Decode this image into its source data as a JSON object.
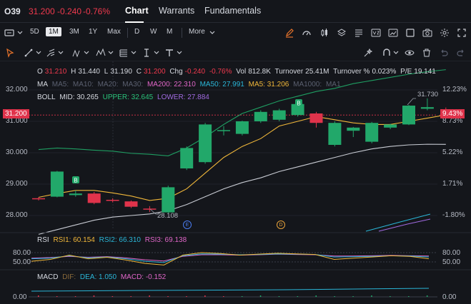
{
  "header": {
    "ticker": "O39",
    "price": "31.200",
    "change": "-0.240",
    "change_pct": "-0.76%",
    "tabs": [
      {
        "label": "Chart",
        "active": true
      },
      {
        "label": "Warrants",
        "active": false
      },
      {
        "label": "Fundamentals",
        "active": false
      }
    ]
  },
  "toolbar": {
    "periods": [
      "5D",
      "1M",
      "3M",
      "1Y",
      "Max"
    ],
    "selected_period": "1M",
    "intervals": [
      "D",
      "W",
      "M"
    ],
    "more_label": "More",
    "accent": "#e8732a"
  },
  "stats": {
    "o_label": "O",
    "o": "31.210",
    "h_label": "H",
    "h": "31.440",
    "l_label": "L",
    "l": "31.190",
    "c_label": "C",
    "c": "31.200",
    "chg_label": "Chg",
    "chg": "-0.240",
    "chg_pct": "-0.76%",
    "vol_label": "Vol",
    "vol": "812.8K",
    "turnover_label": "Turnover",
    "turnover": "25.41M",
    "turnover_pct_label": "Turnover %",
    "turnover_pct": "0.023%",
    "pe_label": "P/E",
    "pe": "19.141"
  },
  "ma_legend": {
    "label": "MA",
    "items": [
      {
        "text": "MA5:",
        "color": "#5b6070"
      },
      {
        "text": "MA10:",
        "color": "#5b6070"
      },
      {
        "text": "MA20:",
        "color": "#5b6070"
      },
      {
        "text": "MA30:",
        "color": "#5b6070"
      },
      {
        "text": "MA200: 22.310",
        "color": "#e066c8"
      },
      {
        "text": "MA50: 27.991",
        "color": "#2ab6d8"
      },
      {
        "text": "MA5: 31.206",
        "color": "#f0b73a"
      },
      {
        "text": "MA1000:",
        "color": "#5b6070"
      },
      {
        "text": "MA1",
        "color": "#5b6070"
      }
    ]
  },
  "boll_legend": {
    "label": "BOLL",
    "mid": "MID: 30.265",
    "upper": "UPPER: 32.645",
    "lower": "LOWER: 27.884"
  },
  "price_axis": [
    "32.000",
    "31.000",
    "30.000",
    "29.000",
    "28.000"
  ],
  "pct_axis": [
    "12.23%",
    "8.73%",
    "5.22%",
    "1.71%",
    "-1.80%"
  ],
  "current_price_tag": "31.200",
  "current_pct_tag": "9.43%",
  "annotations": {
    "high": "31.730",
    "low": "28.108"
  },
  "rsi": {
    "label": "RSI",
    "rsi1": "RSI1: 60.154",
    "rsi2": "RSI2: 66.310",
    "rsi3": "RSI3: 69.138",
    "levels_left": [
      "80.00",
      "50.00"
    ],
    "levels_right": [
      "80.00",
      "50.00"
    ],
    "rsi1_values": [
      52,
      58,
      72,
      60,
      65,
      56,
      45,
      40,
      72,
      80,
      77,
      72,
      75,
      78,
      76,
      74,
      58,
      62,
      66,
      70,
      68,
      60
    ],
    "rsi2_values": [
      60,
      62,
      70,
      63,
      66,
      60,
      52,
      48,
      70,
      76,
      75,
      73,
      74,
      76,
      75,
      74,
      66,
      67,
      68,
      70,
      69,
      66
    ],
    "rsi3_values": [
      62,
      64,
      68,
      65,
      67,
      63,
      57,
      53,
      68,
      73,
      73,
      72,
      73,
      75,
      74,
      73,
      69,
      69,
      70,
      71,
      70,
      69
    ]
  },
  "macd": {
    "label": "MACD",
    "dif": "DIF:",
    "dea": "DEA: 1.050",
    "macd": "MACD: -0.152",
    "level": "0.00"
  },
  "chart_data": {
    "type": "candlestick",
    "candles": [
      {
        "o": 28.55,
        "c": 28.52,
        "h": 28.58,
        "l": 28.48
      },
      {
        "o": 28.6,
        "c": 29.4,
        "h": 29.42,
        "l": 28.58
      },
      {
        "o": 28.65,
        "c": 28.7,
        "h": 28.8,
        "l": 28.6
      },
      {
        "o": 28.7,
        "c": 28.4,
        "h": 28.75,
        "l": 28.36
      },
      {
        "o": 28.5,
        "c": 28.47,
        "h": 28.55,
        "l": 28.42
      },
      {
        "o": 28.45,
        "c": 28.28,
        "h": 28.48,
        "l": 28.24
      },
      {
        "o": 28.22,
        "c": 28.2,
        "h": 28.3,
        "l": 28.108
      },
      {
        "o": 28.1,
        "c": 28.9,
        "h": 28.95,
        "l": 28.08
      },
      {
        "o": 29.5,
        "c": 30.15,
        "h": 30.2,
        "l": 29.45
      },
      {
        "o": 29.7,
        "c": 30.9,
        "h": 30.95,
        "l": 29.65
      },
      {
        "o": 30.7,
        "c": 30.72,
        "h": 30.85,
        "l": 30.55
      },
      {
        "o": 30.6,
        "c": 31.0,
        "h": 31.02,
        "l": 30.55
      },
      {
        "o": 31.0,
        "c": 31.3,
        "h": 31.35,
        "l": 30.95
      },
      {
        "o": 31.05,
        "c": 31.35,
        "h": 31.4,
        "l": 31.0
      },
      {
        "o": 31.2,
        "c": 31.55,
        "h": 31.6,
        "l": 31.15
      },
      {
        "o": 31.25,
        "c": 30.95,
        "h": 31.3,
        "l": 30.8
      },
      {
        "o": 30.25,
        "c": 30.95,
        "h": 31.0,
        "l": 30.2
      },
      {
        "o": 30.7,
        "c": 30.8,
        "h": 30.82,
        "l": 30.5
      },
      {
        "o": 30.35,
        "c": 30.95,
        "h": 30.98,
        "l": 30.3
      },
      {
        "o": 30.8,
        "c": 30.9,
        "h": 30.92,
        "l": 30.75
      },
      {
        "o": 30.9,
        "c": 31.5,
        "h": 31.52,
        "l": 30.88
      },
      {
        "o": 31.4,
        "c": 31.45,
        "h": 31.73,
        "l": 31.35
      },
      {
        "o": 31.21,
        "c": 31.2,
        "h": 31.44,
        "l": 31.19
      }
    ],
    "ma5": [
      28.58,
      28.7,
      28.8,
      28.8,
      28.72,
      28.62,
      28.48,
      28.55,
      28.85,
      29.35,
      29.85,
      30.2,
      30.45,
      30.85,
      31.0,
      31.15,
      31.05,
      30.95,
      30.9,
      30.9,
      31.0,
      31.1,
      31.206
    ],
    "boll_mid": [
      27.4,
      27.55,
      27.7,
      27.85,
      27.95,
      28.0,
      28.05,
      28.15,
      28.35,
      28.6,
      28.85,
      29.05,
      29.2,
      29.4,
      29.55,
      29.7,
      29.85,
      30.0,
      30.12,
      30.2,
      30.25,
      30.27,
      30.265
    ],
    "boll_upper": [
      30.1,
      30.15,
      30.12,
      30.08,
      30.05,
      29.98,
      29.95,
      29.9,
      30.15,
      30.5,
      30.9,
      31.25,
      31.45,
      31.65,
      31.8,
      31.95,
      32.05,
      32.2,
      32.3,
      32.4,
      32.5,
      32.58,
      32.645
    ],
    "boll_lower": [
      24.7,
      24.95,
      25.25,
      25.6,
      25.85,
      26.02,
      26.15,
      26.4,
      26.55,
      26.7,
      26.8,
      26.85,
      26.95,
      27.15,
      27.3,
      27.45,
      27.65,
      27.8,
      27.94,
      28.0,
      27.95,
      27.9,
      27.884
    ],
    "ylim": [
      27.75,
      32.35
    ]
  }
}
